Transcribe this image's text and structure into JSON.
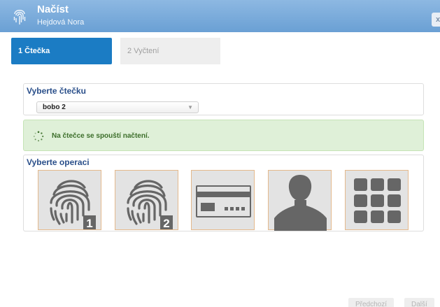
{
  "window": {
    "title": "Načíst",
    "subtitle": "Hejdová Nora",
    "close_label": "x"
  },
  "tabs": [
    {
      "label": "1 Čtečka",
      "active": true
    },
    {
      "label": "2 Vyčtení",
      "active": false
    }
  ],
  "reader": {
    "heading": "Vyberte čtečku",
    "selected": "bobo 2"
  },
  "status": {
    "message": "Na čtečce se spouští načtení."
  },
  "operations": {
    "heading": "Vyberte operaci",
    "items": [
      {
        "icon": "fingerprint-icon",
        "badge": "1"
      },
      {
        "icon": "fingerprint-icon",
        "badge": "2"
      },
      {
        "icon": "card-icon"
      },
      {
        "icon": "person-icon"
      },
      {
        "icon": "grid-icon"
      }
    ]
  },
  "footer": {
    "prev_label": "Předchozí",
    "next_label": "Další"
  },
  "colors": {
    "accent": "#1b7cc4",
    "titlebar": "#6aa0d4",
    "status_bg": "#dff0d8",
    "status_text": "#3c6e2a",
    "tile_border": "#e4b98c",
    "icon_gray": "#666666"
  }
}
